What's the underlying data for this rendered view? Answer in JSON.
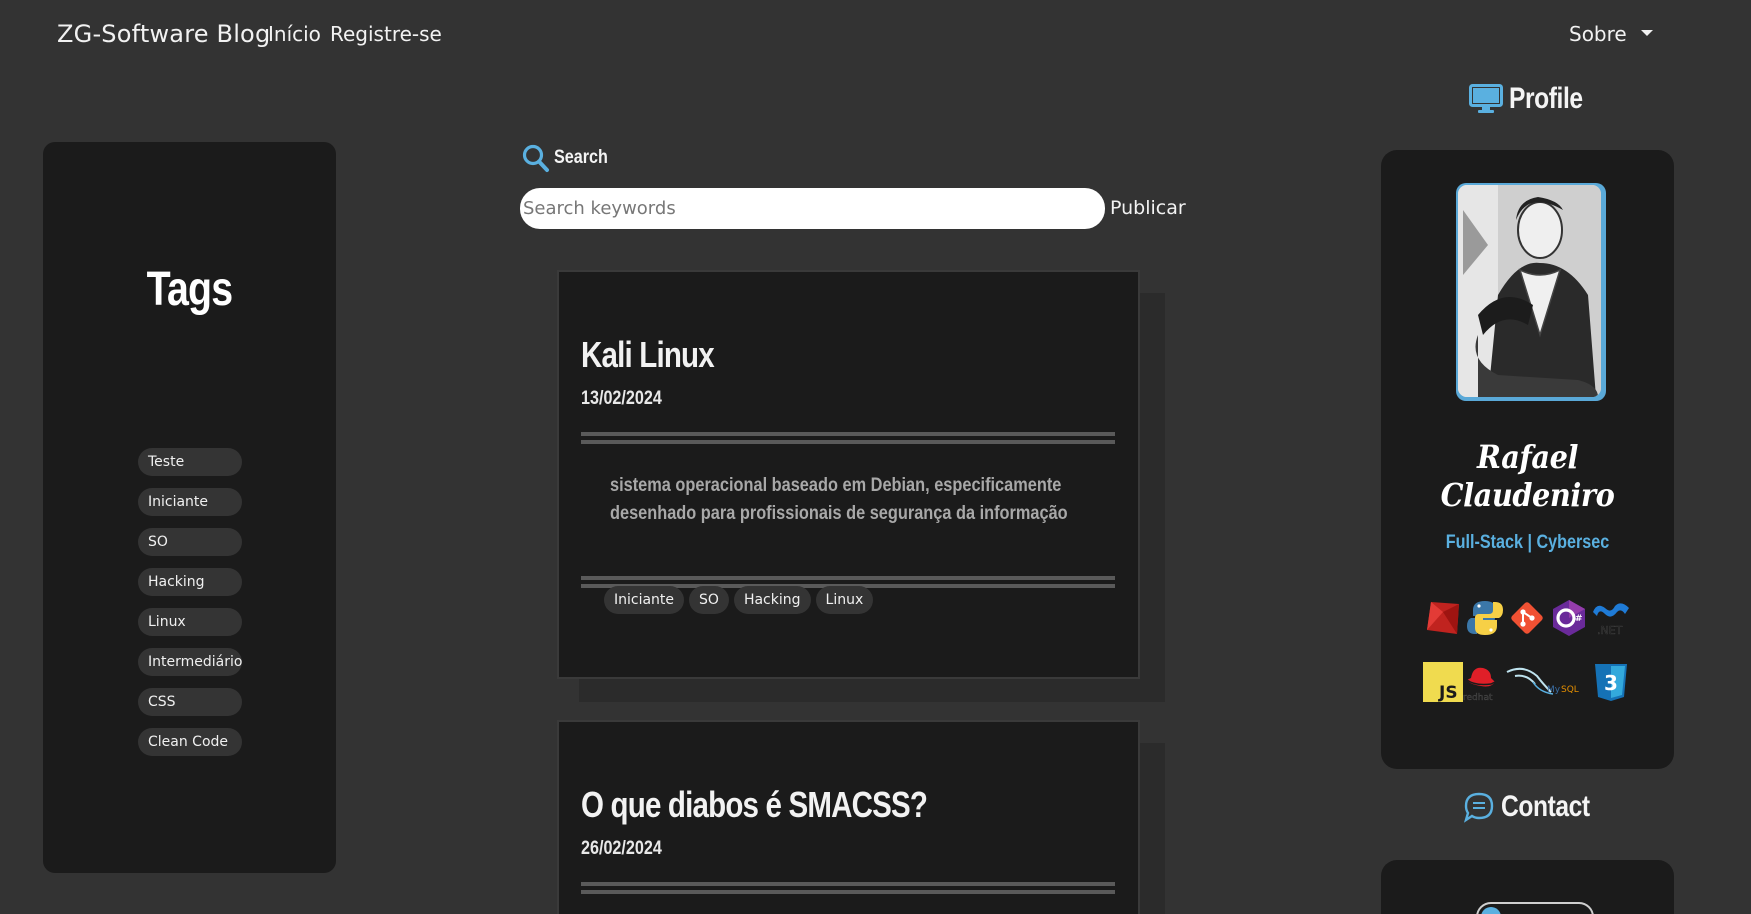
{
  "navbar": {
    "brand": "ZG-Software Blog",
    "links": [
      "Início",
      "Registre-se"
    ],
    "about": "Sobre"
  },
  "tags": {
    "title": "Tags",
    "items": [
      "Teste",
      "Iniciante",
      "SO",
      "Hacking",
      "Linux",
      "Intermediário",
      "CSS",
      "Clean Code"
    ]
  },
  "search": {
    "label": "Search",
    "placeholder": "Search keywords",
    "publish": "Publicar"
  },
  "posts": [
    {
      "title": "Kali Linux",
      "date": "13/02/2024",
      "description_lines": [
        "sistema operacional baseado em Debian, especificamente",
        "desenhado para profissionais de segurança da informação"
      ],
      "tags": [
        "Iniciante",
        "SO",
        "Hacking",
        "Linux"
      ]
    },
    {
      "title": "O que diabos é SMACSS?",
      "date": "26/02/2024"
    }
  ],
  "profile": {
    "heading": "Profile",
    "name": "Rafael Claudeniro",
    "role": "Full-Stack | Cybersec",
    "tech_icons_row1": [
      "ruby-icon",
      "python-icon",
      "git-icon",
      "csharp-icon",
      "dotnet-icon"
    ],
    "tech_icons_row2": [
      "javascript-icon",
      "redhat-icon",
      "mysql-icon",
      "css3-icon"
    ]
  },
  "contact": {
    "heading": "Contact"
  },
  "colors": {
    "background": "#333333",
    "panel": "#1b1b1b",
    "accent": "#5ab0e0"
  }
}
